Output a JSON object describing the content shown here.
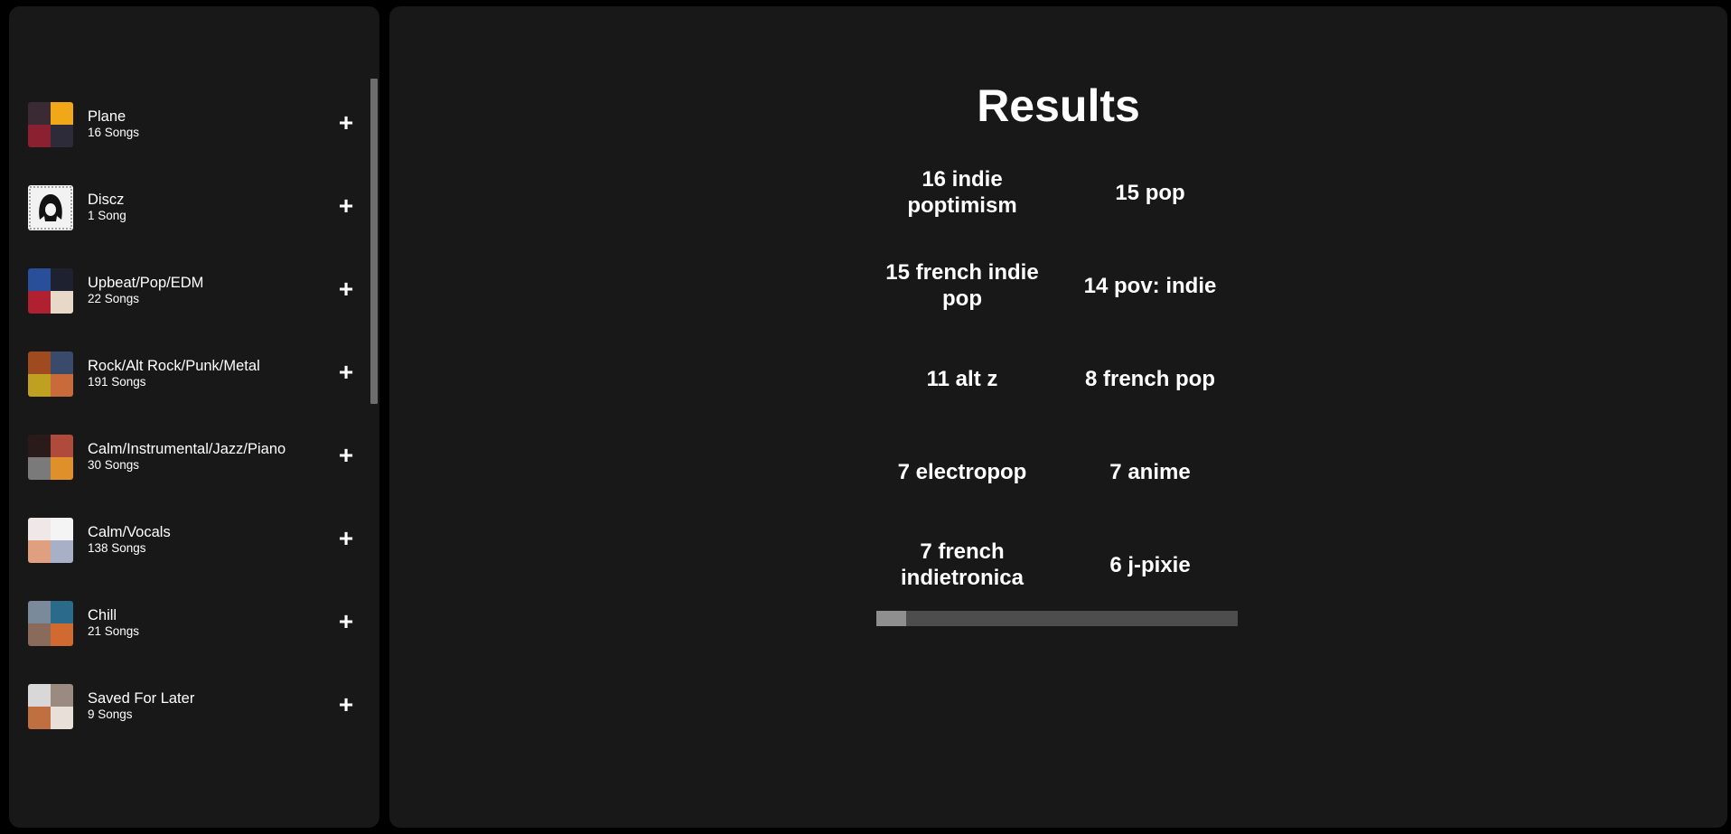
{
  "sidebar": {
    "playlists": [
      {
        "name": "Plane",
        "count": "16 Songs",
        "cover": [
          "#3a2a33",
          "#f0a818",
          "#8a2030",
          "#2d2a3a"
        ]
      },
      {
        "name": "Discz",
        "count": "1 Song",
        "cover": [
          "#f2f2f2"
        ]
      },
      {
        "name": "Upbeat/Pop/EDM",
        "count": "22 Songs",
        "cover": [
          "#2a4f9a",
          "#1e2230",
          "#b02030",
          "#e8d8c8"
        ]
      },
      {
        "name": "Rock/Alt Rock/Punk/Metal",
        "count": "191 Songs",
        "cover": [
          "#a04a20",
          "#3a4a6a",
          "#c0a020",
          "#c86a3a"
        ]
      },
      {
        "name": "Calm/Instrumental/Jazz/Piano",
        "count": "30 Songs",
        "cover": [
          "#2a1a1a",
          "#b04a3a",
          "#7a7a7a",
          "#e0902a"
        ]
      },
      {
        "name": "Calm/Vocals",
        "count": "138 Songs",
        "cover": [
          "#f0e8e8",
          "#f4f4f4",
          "#e0a080",
          "#a8b0c8"
        ]
      },
      {
        "name": "Chill",
        "count": "21 Songs",
        "cover": [
          "#7a8a9a",
          "#2a6a8a",
          "#8a6a5a",
          "#d06a30"
        ]
      },
      {
        "name": "Saved For Later",
        "count": "9 Songs",
        "cover": [
          "#d8d8d8",
          "#9a8a80",
          "#c07040",
          "#e8e0d8"
        ]
      }
    ],
    "add_label": "+"
  },
  "main": {
    "title": "Results",
    "genres": [
      "16 indie poptimism",
      "15 pop",
      "15 french indie pop",
      "14 pov: indie",
      "11 alt z",
      "8 french pop",
      "7 electropop",
      "7 anime",
      "7 french indietronica",
      "6 j-pixie"
    ],
    "scroll_position": 0.08
  },
  "colors": {
    "background": "#000000",
    "panel": "#181818",
    "text": "#ffffff"
  }
}
